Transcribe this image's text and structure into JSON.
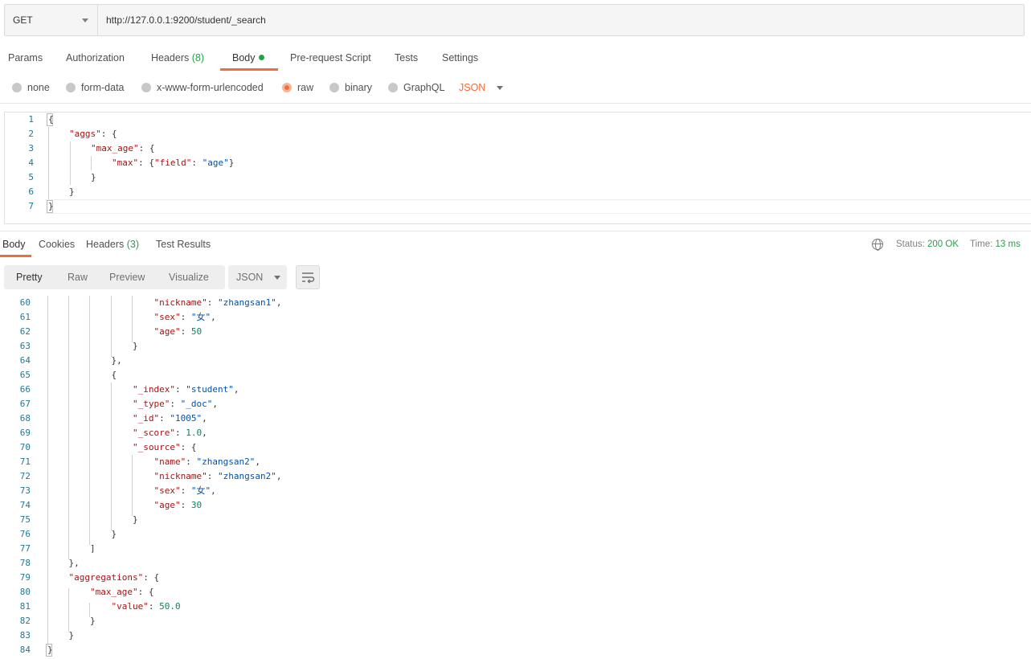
{
  "request": {
    "method": "GET",
    "url": "http://127.0.0.1:9200/student/_search"
  },
  "request_tabs": {
    "params": "Params",
    "authorization": "Authorization",
    "headers": "Headers",
    "headers_count": "(8)",
    "body": "Body",
    "pre_request": "Pre-request Script",
    "tests": "Tests",
    "settings": "Settings"
  },
  "body_types": {
    "none": "none",
    "form_data": "form-data",
    "urlencoded": "x-www-form-urlencoded",
    "raw": "raw",
    "binary": "binary",
    "graphql": "GraphQL",
    "selected": "raw",
    "language": "JSON"
  },
  "request_body": {
    "line_numbers": [
      "1",
      "2",
      "3",
      "4",
      "5",
      "6",
      "7"
    ],
    "lines": [
      [
        "{"
      ],
      [
        "\"aggs\"",
        ": {"
      ],
      [
        "\"max_age\"",
        ": {"
      ],
      [
        "\"max\"",
        ": {",
        "\"field\"",
        ": ",
        "\"age\"",
        "}"
      ],
      [
        "}"
      ],
      [
        "}"
      ],
      [
        "}"
      ]
    ]
  },
  "response_tabs": {
    "body": "Body",
    "cookies": "Cookies",
    "headers": "Headers",
    "headers_count": "(3)",
    "test_results": "Test Results",
    "status_label": "Status:",
    "status_value": "200 OK",
    "time_label": "Time:",
    "time_value": "13 ms"
  },
  "view_modes": {
    "pretty": "Pretty",
    "raw": "Raw",
    "preview": "Preview",
    "visualize": "Visualize",
    "format": "JSON"
  },
  "response_body": {
    "lines": [
      {
        "n": "60",
        "t": [
          [
            "k",
            "\"nickname\""
          ],
          [
            "p",
            ": "
          ],
          [
            "s",
            "\"zhangsan1\""
          ],
          [
            "p",
            ","
          ]
        ]
      },
      {
        "n": "61",
        "t": [
          [
            "k",
            "\"sex\""
          ],
          [
            "p",
            ": "
          ],
          [
            "s",
            "\"女\""
          ],
          [
            "p",
            ","
          ]
        ]
      },
      {
        "n": "62",
        "t": [
          [
            "k",
            "\"age\""
          ],
          [
            "p",
            ": "
          ],
          [
            "n",
            "50"
          ]
        ]
      },
      {
        "n": "63",
        "t": [
          [
            "p",
            "}"
          ]
        ]
      },
      {
        "n": "64",
        "t": [
          [
            "p",
            "},"
          ]
        ]
      },
      {
        "n": "65",
        "t": [
          [
            "p",
            "{"
          ]
        ]
      },
      {
        "n": "66",
        "t": [
          [
            "k",
            "\"_index\""
          ],
          [
            "p",
            ": "
          ],
          [
            "s",
            "\"student\""
          ],
          [
            "p",
            ","
          ]
        ]
      },
      {
        "n": "67",
        "t": [
          [
            "k",
            "\"_type\""
          ],
          [
            "p",
            ": "
          ],
          [
            "s",
            "\"_doc\""
          ],
          [
            "p",
            ","
          ]
        ]
      },
      {
        "n": "68",
        "t": [
          [
            "k",
            "\"_id\""
          ],
          [
            "p",
            ": "
          ],
          [
            "s",
            "\"1005\""
          ],
          [
            "p",
            ","
          ]
        ]
      },
      {
        "n": "69",
        "t": [
          [
            "k",
            "\"_score\""
          ],
          [
            "p",
            ": "
          ],
          [
            "n",
            "1.0"
          ],
          [
            "p",
            ","
          ]
        ]
      },
      {
        "n": "70",
        "t": [
          [
            "k",
            "\"_source\""
          ],
          [
            "p",
            ": {"
          ]
        ]
      },
      {
        "n": "71",
        "t": [
          [
            "k",
            "\"name\""
          ],
          [
            "p",
            ": "
          ],
          [
            "s",
            "\"zhangsan2\""
          ],
          [
            "p",
            ","
          ]
        ]
      },
      {
        "n": "72",
        "t": [
          [
            "k",
            "\"nickname\""
          ],
          [
            "p",
            ": "
          ],
          [
            "s",
            "\"zhangsan2\""
          ],
          [
            "p",
            ","
          ]
        ]
      },
      {
        "n": "73",
        "t": [
          [
            "k",
            "\"sex\""
          ],
          [
            "p",
            ": "
          ],
          [
            "s",
            "\"女\""
          ],
          [
            "p",
            ","
          ]
        ]
      },
      {
        "n": "74",
        "t": [
          [
            "k",
            "\"age\""
          ],
          [
            "p",
            ": "
          ],
          [
            "n",
            "30"
          ]
        ]
      },
      {
        "n": "75",
        "t": [
          [
            "p",
            "}"
          ]
        ]
      },
      {
        "n": "76",
        "t": [
          [
            "p",
            "}"
          ]
        ]
      },
      {
        "n": "77",
        "t": [
          [
            "p",
            "]"
          ]
        ]
      },
      {
        "n": "78",
        "t": [
          [
            "p",
            "},"
          ]
        ]
      },
      {
        "n": "79",
        "t": [
          [
            "k",
            "\"aggregations\""
          ],
          [
            "p",
            ": {"
          ]
        ]
      },
      {
        "n": "80",
        "t": [
          [
            "k",
            "\"max_age\""
          ],
          [
            "p",
            ": {"
          ]
        ]
      },
      {
        "n": "81",
        "t": [
          [
            "k",
            "\"value\""
          ],
          [
            "p",
            ": "
          ],
          [
            "n",
            "50.0"
          ]
        ]
      },
      {
        "n": "82",
        "t": [
          [
            "p",
            "}"
          ]
        ]
      },
      {
        "n": "83",
        "t": [
          [
            "p",
            "}"
          ]
        ]
      },
      {
        "n": "84",
        "t": [
          [
            "p",
            "}"
          ]
        ]
      }
    ]
  },
  "colors": {
    "accent": "#f26b3a",
    "success": "#26a14a",
    "json_key": "#a31515",
    "json_string": "#0451a5",
    "json_number": "#098658",
    "line_number": "#237893"
  }
}
